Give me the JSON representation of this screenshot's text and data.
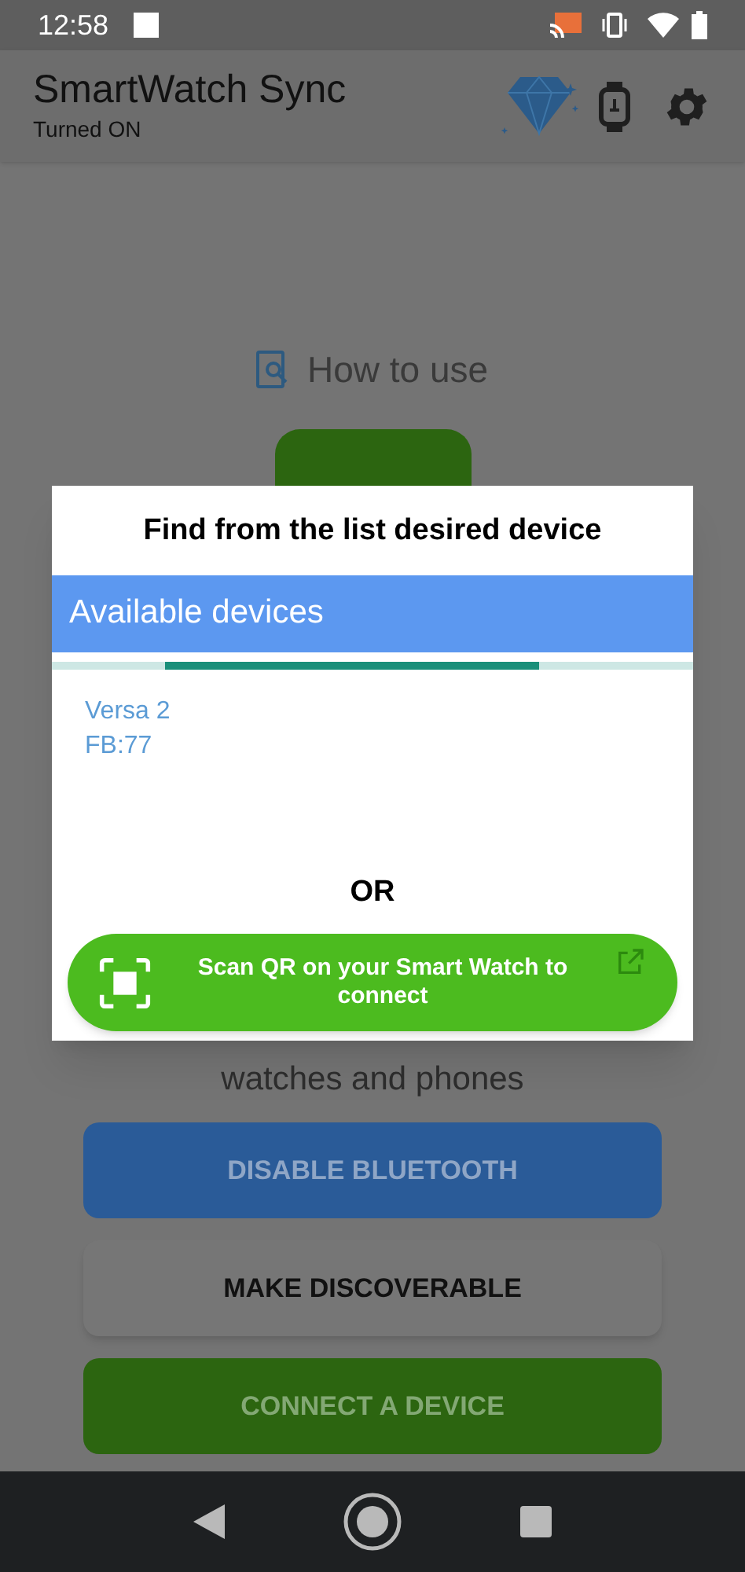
{
  "status_bar": {
    "time": "12:58"
  },
  "app_bar": {
    "title": "SmartWatch Sync",
    "subtitle": "Turned ON"
  },
  "how_to_use": {
    "label": "How to use"
  },
  "hint_text": "watches and phones",
  "buttons": [
    {
      "label": "DISABLE BLUETOOTH",
      "kind": "blue"
    },
    {
      "label": "MAKE DISCOVERABLE",
      "kind": "plain"
    },
    {
      "label": "CONNECT A DEVICE",
      "kind": "green"
    }
  ],
  "dialog": {
    "title": "Find from the list desired device",
    "header": "Available devices",
    "devices": [
      {
        "name": "Versa 2",
        "address": "FB:77"
      }
    ],
    "or_label": "OR",
    "scan_button": "Scan QR on your Smart Watch to connect"
  }
}
